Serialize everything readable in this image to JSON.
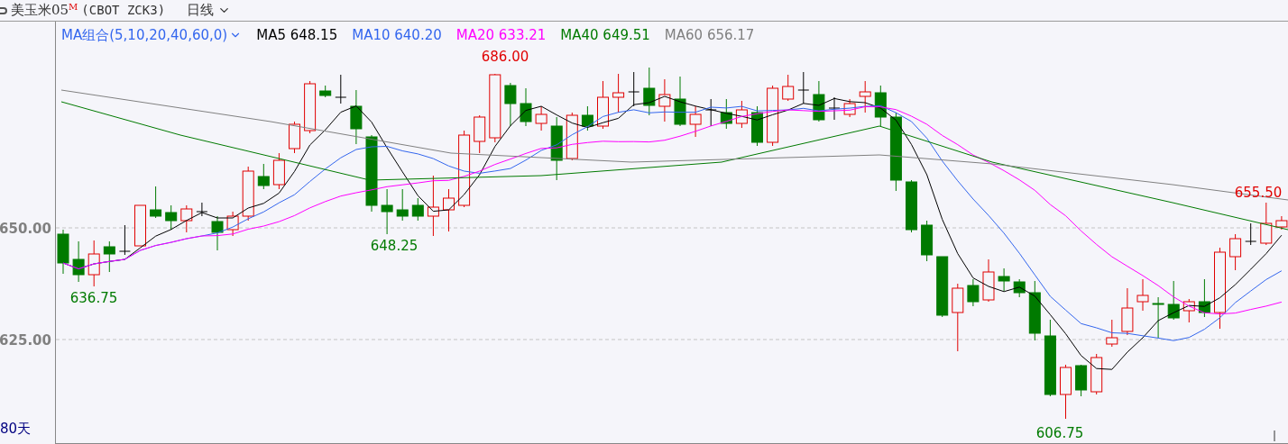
{
  "header": {
    "symbol": "美玉米05",
    "superscript": "M",
    "code": "(CBOT ZCK3)",
    "period": "日线"
  },
  "ma_selector": "MA组合(5,10,20,40,60,0)",
  "ma_legend": [
    {
      "label": "MA5 648.15",
      "color": "#000000"
    },
    {
      "label": "MA10 640.20",
      "color": "#3366ee"
    },
    {
      "label": "MA20 633.21",
      "color": "#ff00ff"
    },
    {
      "label": "MA40 649.51",
      "color": "#007a00"
    },
    {
      "label": "MA60 656.17",
      "color": "#808080"
    }
  ],
  "y_axis": [
    "650.00",
    "625.00"
  ],
  "annotations": [
    {
      "text": "686.00",
      "color": "#e00000"
    },
    {
      "text": "648.25",
      "color": "#007a00"
    },
    {
      "text": "636.75",
      "color": "#007a00"
    },
    {
      "text": "606.75",
      "color": "#007a00"
    },
    {
      "text": "655.50",
      "color": "#e00000"
    }
  ],
  "range_label": "80天"
}
